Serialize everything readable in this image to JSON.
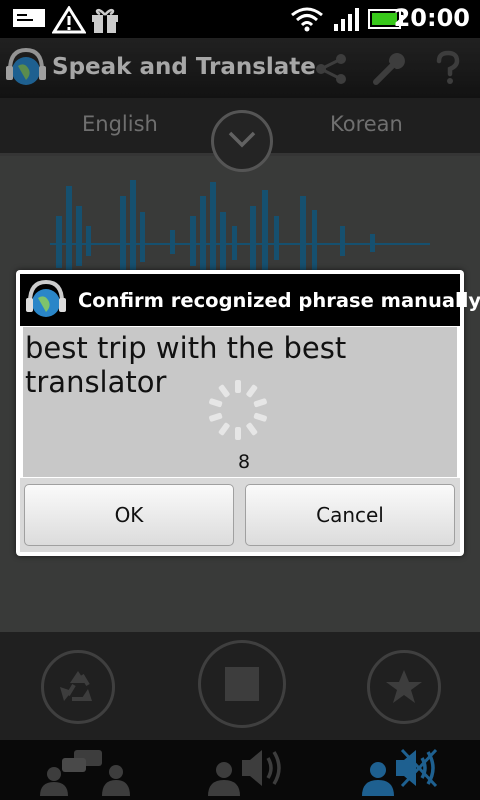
{
  "status_bar": {
    "time": "20:00",
    "icons": [
      "message-icon",
      "warning-icon",
      "gift-icon",
      "wifi-icon",
      "signal-icon",
      "battery-icon"
    ]
  },
  "app_bar": {
    "title": "Speak and Translate",
    "icons": [
      "app-logo-icon",
      "share-icon",
      "wrench-icon",
      "help-icon"
    ]
  },
  "language_bar": {
    "source": "English",
    "target": "Korean"
  },
  "dialog": {
    "title": "Confirm recognized phrase manually",
    "phrase": "best trip with the best translator",
    "countdown": "8",
    "ok_label": "OK",
    "cancel_label": "Cancel"
  },
  "controls": {
    "icons": [
      "recycle-icon",
      "stop-icon",
      "star-icon"
    ]
  },
  "bottom_bar": {
    "icons": [
      "conversation-icon",
      "speaker-icon",
      "mute-speaker-icon"
    ],
    "active_icon": "mute-speaker-icon",
    "active_color": "#2a86c8"
  },
  "colors": {
    "accent": "#2a86c8",
    "waveform": "#1f6f9a"
  }
}
